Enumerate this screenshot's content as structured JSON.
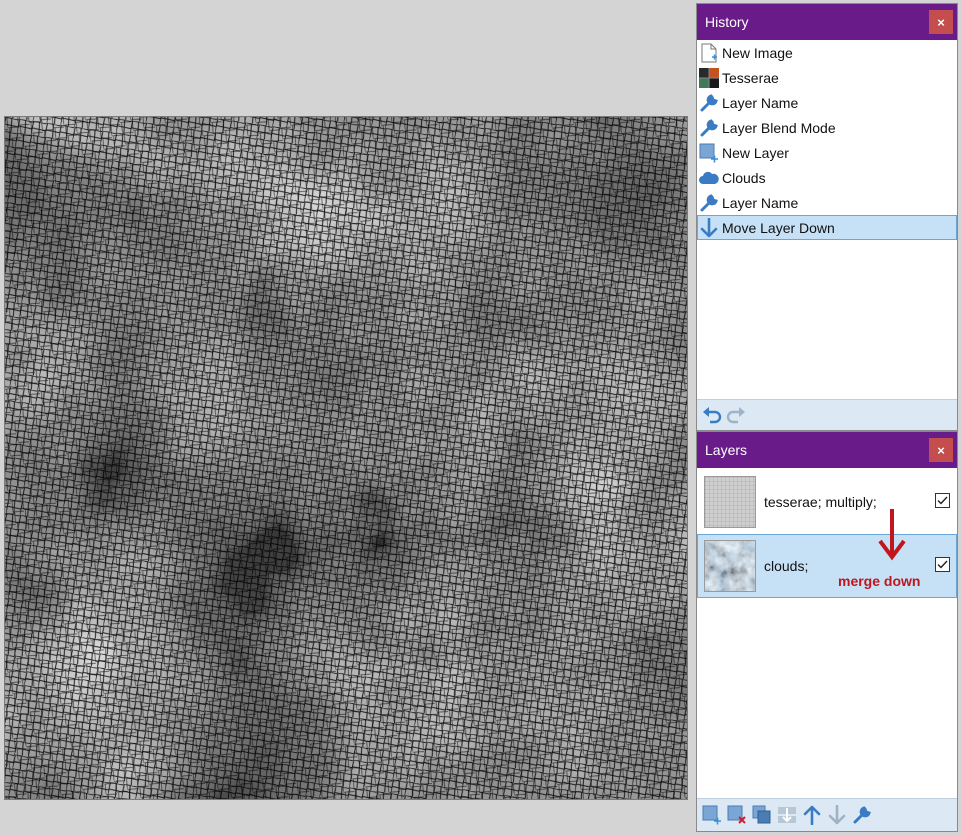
{
  "history": {
    "title": "History",
    "close_label": "×",
    "items": [
      {
        "label": "New Image",
        "icon": "new-image-icon"
      },
      {
        "label": "Tesserae",
        "icon": "tesserae-icon"
      },
      {
        "label": "Layer Name",
        "icon": "wrench-icon"
      },
      {
        "label": "Layer Blend Mode",
        "icon": "wrench-icon"
      },
      {
        "label": "New Layer",
        "icon": "new-layer-icon"
      },
      {
        "label": "Clouds",
        "icon": "clouds-icon"
      },
      {
        "label": "Layer Name",
        "icon": "wrench-icon"
      },
      {
        "label": "Move Layer Down",
        "icon": "arrow-down-icon",
        "selected": true
      }
    ],
    "footer": [
      "undo-icon",
      "redo-icon"
    ]
  },
  "layers": {
    "title": "Layers",
    "close_label": "×",
    "items": [
      {
        "name": "tesserae; multiply;",
        "visible": true,
        "selected": false
      },
      {
        "name": "clouds;",
        "visible": true,
        "selected": true
      }
    ],
    "annotation": "merge down",
    "footer": [
      "add-layer-icon",
      "delete-layer-icon",
      "duplicate-layer-icon",
      "merge-layer-down-icon",
      "move-layer-up-icon",
      "move-layer-down-icon",
      "layer-properties-icon"
    ]
  },
  "colors": {
    "panel_header": "#6a1b8a",
    "selection": "#c6e0f5",
    "annotation": "#c0161c",
    "close_button": "#c44d4d"
  }
}
